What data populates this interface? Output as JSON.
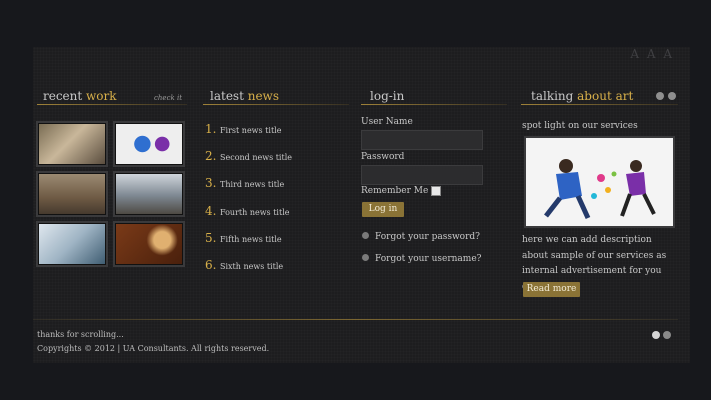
{
  "header": {
    "font_size_control": "A A A"
  },
  "recent_work": {
    "title_plain": "recent ",
    "title_accent": "work",
    "link": "check it",
    "thumbs": [
      "image-1",
      "image-2",
      "image-3",
      "image-4",
      "image-5",
      "image-6"
    ]
  },
  "latest_news": {
    "title_plain": "latest ",
    "title_accent": "news",
    "items": [
      {
        "num": "1.",
        "title": "First news title"
      },
      {
        "num": "2.",
        "title": "Second news title"
      },
      {
        "num": "3.",
        "title": "Third news title"
      },
      {
        "num": "4.",
        "title": "Fourth news title"
      },
      {
        "num": "5.",
        "title": "Fifth news title"
      },
      {
        "num": "6.",
        "title": "Sixth news title"
      }
    ]
  },
  "login": {
    "title": "log-in",
    "username_label": "User Name",
    "password_label": "Password",
    "remember_label": "Remember Me",
    "login_button": "Log in",
    "forgot_password": "Forgot your password?",
    "forgot_username": "Forgot your username?"
  },
  "talking_about_art": {
    "title_plain": "talking ",
    "title_accent": "about art",
    "subtitle": "spot light on our services",
    "description": "here we can add description about sample of our services as internal advertisement for you or...",
    "read_more": "Read more"
  },
  "footer": {
    "thanks": "thanks for scrolling...",
    "copyright": "Copyrights © 2012 | UA Consultants. All rights reserved."
  },
  "colors": {
    "accent": "#d8b04a",
    "button": "#8a7336",
    "background": "#1d1d1f"
  }
}
